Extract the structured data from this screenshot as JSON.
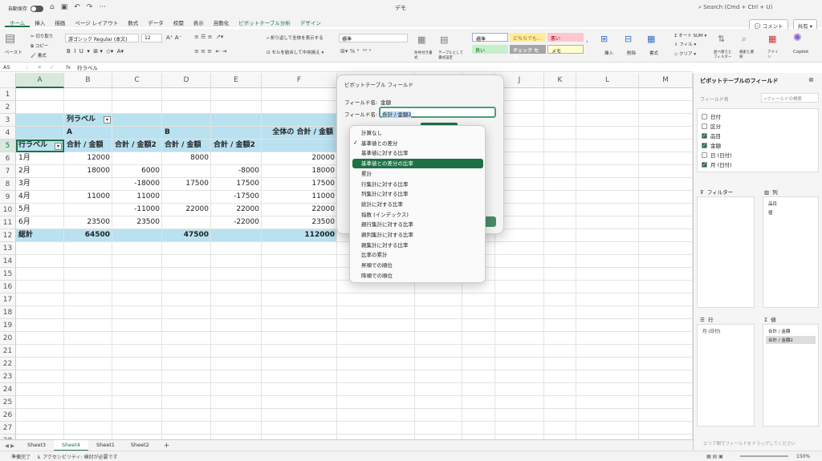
{
  "titlebar": {
    "autosave": "自動保存",
    "title": "デモ",
    "search": "Search (Cmd + Ctrl + U)"
  },
  "tabs": [
    "ホーム",
    "挿入",
    "描画",
    "ページ レイアウト",
    "数式",
    "データ",
    "校閲",
    "表示",
    "自動化",
    "ピボットテーブル分析",
    "デザイン"
  ],
  "tab_right": {
    "comment": "コメント",
    "share": "共有"
  },
  "ribbon": {
    "paste": "ペースト",
    "cut": "切り取り",
    "copy": "コピー",
    "format": "書式",
    "font": "游ゴシック Regular (本文)",
    "size": "12",
    "wrap": "折り返して全体を表示する",
    "merge": "セルを結合して中央揃え",
    "numfmt": "標準",
    "cond": "条件付き書式",
    "table": "テーブルとして書式設定",
    "styles": [
      "標準",
      "どちらでも...",
      "悪い",
      "良い",
      "チェック セル",
      "メモ"
    ],
    "insert": "挿入",
    "delete": "削除",
    "fmt": "書式",
    "autosum": "オート SUM",
    "fill": "フィル",
    "clear": "クリア",
    "sort": "並べ替えとフィルター",
    "find": "検索と選択",
    "addin": "アドイン",
    "copilot": "Copilot"
  },
  "formula_bar": {
    "cell": "A5",
    "fx": "fx",
    "value": "行ラベル"
  },
  "columns": [
    "A",
    "B",
    "C",
    "D",
    "E",
    "F",
    "G",
    "H",
    "I",
    "J",
    "K",
    "L",
    "M"
  ],
  "rows": [
    "1",
    "2",
    "3",
    "4",
    "5",
    "6",
    "7",
    "8",
    "9",
    "10",
    "11",
    "12",
    "13",
    "14",
    "15",
    "16",
    "17",
    "18",
    "19",
    "20",
    "21",
    "22",
    "23",
    "24",
    "25",
    "26",
    "27",
    "28"
  ],
  "pivot": {
    "col_labels": "列ラベル",
    "group_a": "A",
    "group_b": "B",
    "grand_header": "全体の 合計 / 金額",
    "row_labels": "行ラベル",
    "h1": "合計 / 金額",
    "h2": "合計 / 金額2",
    "h3": "合計 / 金額",
    "h4": "合計 / 金額2",
    "data": [
      {
        "m": "1月",
        "b": "12000",
        "c": "",
        "d": "8000",
        "e": "",
        "f": "20000"
      },
      {
        "m": "2月",
        "b": "18000",
        "c": "6000",
        "d": "",
        "e": "-8000",
        "f": "18000"
      },
      {
        "m": "3月",
        "b": "",
        "c": "-18000",
        "d": "17500",
        "e": "17500",
        "f": "17500"
      },
      {
        "m": "4月",
        "b": "11000",
        "c": "11000",
        "d": "",
        "e": "-17500",
        "f": "11000"
      },
      {
        "m": "5月",
        "b": "",
        "c": "-11000",
        "d": "22000",
        "e": "22000",
        "f": "22000"
      },
      {
        "m": "6月",
        "b": "23500",
        "c": "23500",
        "d": "",
        "e": "-22000",
        "f": "23500"
      }
    ],
    "total_label": "総計",
    "total_b": "64500",
    "total_d": "47500",
    "total_f": "112000"
  },
  "sheets": [
    "Sheet3",
    "Sheet4",
    "Sheet1",
    "Sheet2"
  ],
  "status": {
    "ready": "準備完了",
    "access": "アクセシビリティ: 検討が必要です",
    "zoom": "150%"
  },
  "dialog": {
    "title": "ピボットテーブル フィールド",
    "field_name_label": "フィールド名:",
    "field_name": "金額",
    "field_name2_label": "フィールド名:",
    "field_name2": "合計 / 金額2"
  },
  "menu": [
    "計算なし",
    "基準値との差分",
    "基準値に対する比率",
    "基準値との差分の比率",
    "累計",
    "行集計に対する比率",
    "列集計に対する比率",
    "総計に対する比率",
    "指数 (インデックス)",
    "親行集計に対する比率",
    "親列集計に対する比率",
    "親集計に対する比率",
    "比率の累計",
    "昇順での順位",
    "降順での順位"
  ],
  "panel": {
    "title": "ピボットテーブルのフィールド",
    "field_label": "フィールド名",
    "search": "フィールドの検索",
    "fields": [
      {
        "name": "日付",
        "checked": false
      },
      {
        "name": "区分",
        "checked": false
      },
      {
        "name": "品目",
        "checked": true
      },
      {
        "name": "金額",
        "checked": true
      },
      {
        "name": "日 (日付)",
        "checked": false
      },
      {
        "name": "月 (日付)",
        "checked": true
      }
    ],
    "filter": "フィルター",
    "columns": "列",
    "rows": "行",
    "values": "値",
    "col_items": [
      "品目",
      "値"
    ],
    "row_items": [
      "月 (日付)"
    ],
    "value_items": [
      "合計 / 金額",
      "合計 / 金額2"
    ],
    "drag_hint": "エリア間でフィールドをドラッグしてください"
  }
}
